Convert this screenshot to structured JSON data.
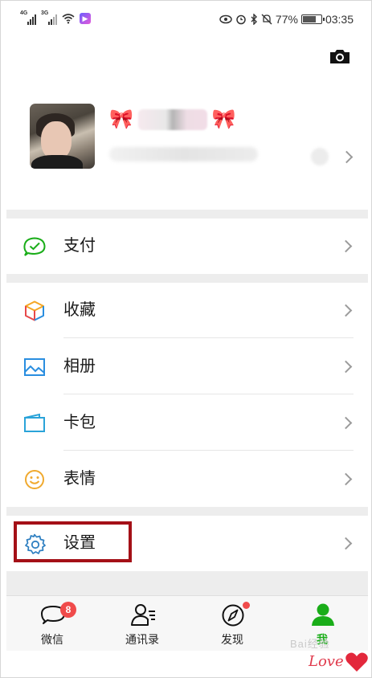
{
  "status_bar": {
    "network_1": "4G",
    "network_2": "3G",
    "battery_percent": "77%",
    "battery_level": 0.77,
    "time": "03:35"
  },
  "menu": [
    {
      "label": "支付",
      "icon": "payment-icon",
      "color": "#1aad19"
    },
    {
      "label": "收藏",
      "icon": "favorites-cube-icon",
      "color": "#f5a623"
    },
    {
      "label": "相册",
      "icon": "album-icon",
      "color": "#2a8ee0"
    },
    {
      "label": "卡包",
      "icon": "card-wallet-icon",
      "color": "#2aa3d9"
    },
    {
      "label": "表情",
      "icon": "emoji-icon",
      "color": "#f0a92e"
    },
    {
      "label": "设置",
      "icon": "gear-icon",
      "color": "#2e7fc1"
    }
  ],
  "tabs": [
    {
      "label": "微信",
      "icon": "chat-bubble-icon",
      "badge": "8"
    },
    {
      "label": "通讯录",
      "icon": "contacts-icon"
    },
    {
      "label": "发现",
      "icon": "compass-icon"
    },
    {
      "label": "我",
      "icon": "me-person-icon",
      "active": true
    }
  ],
  "colors": {
    "accent_green": "#1aad19",
    "badge_red": "#f04b4b",
    "highlight_box": "#a41017"
  },
  "watermark": {
    "text": "Bai经验",
    "love": "Love"
  }
}
